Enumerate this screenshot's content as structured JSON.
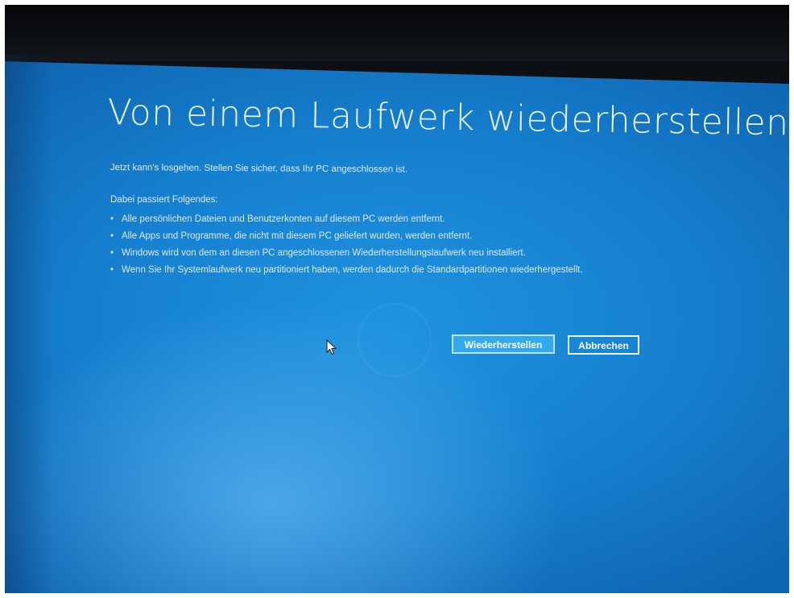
{
  "screen": {
    "title": "Von einem Laufwerk wiederherstellen",
    "subtitle": "Jetzt kann's losgehen. Stellen Sie sicher, dass Ihr PC angeschlossen ist.",
    "intro": "Dabei passiert Folgendes:",
    "bullet_glyph": "•",
    "bullets": [
      "Alle persönlichen Dateien und Benutzerkonten auf diesem PC werden entfernt.",
      "Alle Apps und Programme, die nicht mit diesem PC geliefert wurden, werden entfernt.",
      "Windows wird von dem an diesen PC angeschlossenen Wiederherstellungslaufwerk neu installiert.",
      "Wenn Sie Ihr Systemlaufwerk neu partitioniert haben, werden dadurch die Standardpartitionen wiederhergestellt."
    ]
  },
  "buttons": {
    "primary_label": "Wiederherstellen",
    "secondary_label": "Abbrechen"
  },
  "colors": {
    "background": "#1a86d4",
    "primary_button": "#31aaf0",
    "text": "#e8f3fb"
  },
  "icons": {
    "cursor": "mouse-pointer-icon"
  }
}
